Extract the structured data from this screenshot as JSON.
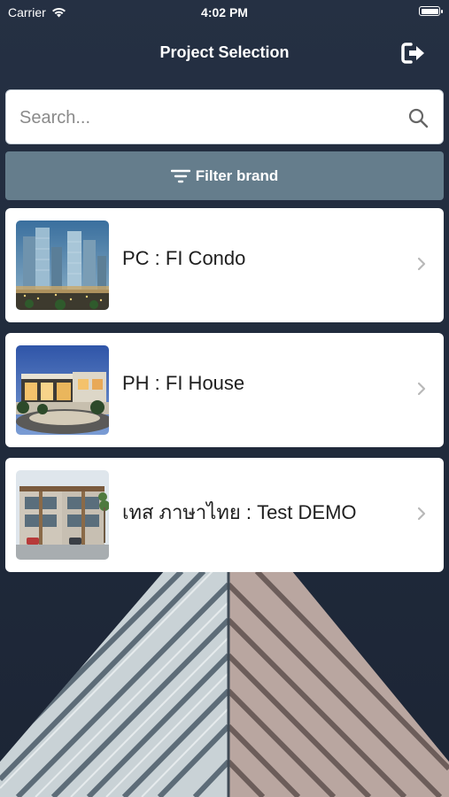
{
  "status_bar": {
    "carrier": "Carrier",
    "time": "4:02 PM"
  },
  "header": {
    "title": "Project Selection",
    "logout_icon": "logout-icon"
  },
  "search": {
    "placeholder": "Search...",
    "value": "",
    "icon": "search-icon"
  },
  "filter": {
    "label": "Filter brand",
    "icon": "filter-icon"
  },
  "projects": [
    {
      "name": "PC : FI Condo",
      "thumbnail": "condo-towers-image"
    },
    {
      "name": "PH : FI House",
      "thumbnail": "house-dusk-image"
    },
    {
      "name": "เทส ภาษาไทย : Test DEMO",
      "thumbnail": "townhouse-image"
    }
  ],
  "colors": {
    "background": "#1f2a3a",
    "filter_button": "#657d8c",
    "card": "#ffffff",
    "chevron": "#b8b8b8"
  }
}
